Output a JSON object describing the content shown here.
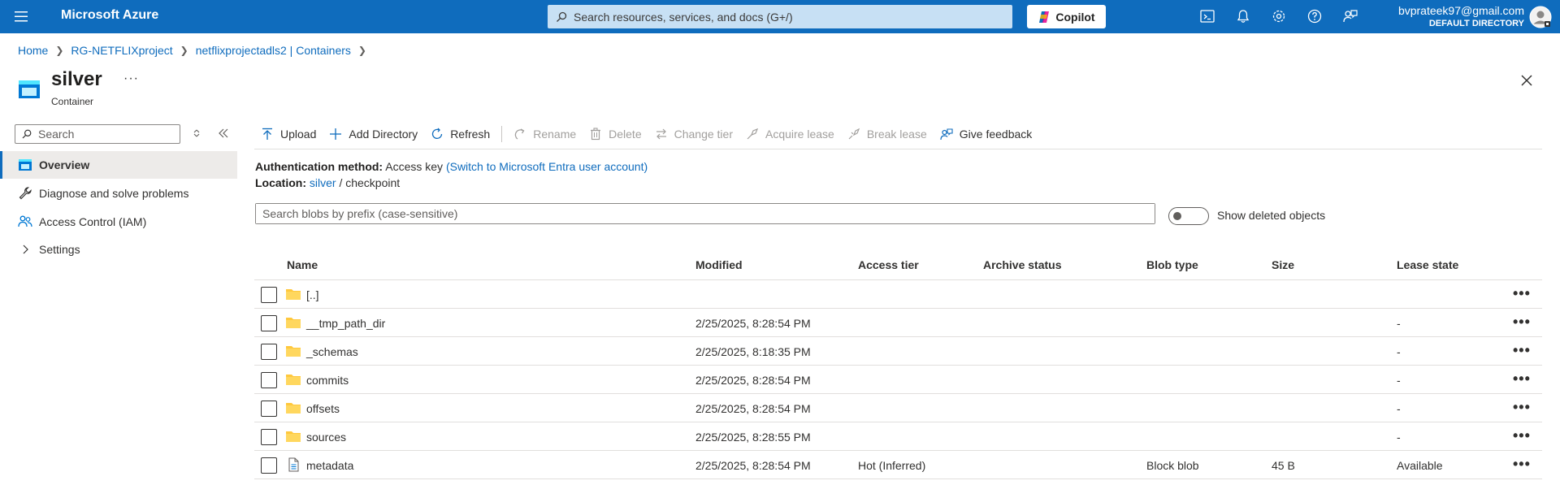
{
  "topbar": {
    "brand": "Microsoft Azure",
    "search_placeholder": "Search resources, services, and docs (G+/)",
    "copilot_label": "Copilot",
    "account_email": "bvprateek97@gmail.com",
    "account_directory": "DEFAULT DIRECTORY",
    "icons": [
      "cloud-shell-icon",
      "bell-icon",
      "gear-icon",
      "help-icon",
      "feedback-icon"
    ]
  },
  "breadcrumb": {
    "items": [
      "Home",
      "RG-NETFLIXproject",
      "netflixprojectadls2 | Containers"
    ]
  },
  "header": {
    "title": "silver",
    "subtitle": "Container",
    "more": "···"
  },
  "nav": {
    "search_placeholder": "Search",
    "items": [
      {
        "label": "Overview",
        "icon": "container-icon",
        "active": true
      },
      {
        "label": "Diagnose and solve problems",
        "icon": "wrench-icon"
      },
      {
        "label": "Access Control (IAM)",
        "icon": "people-icon"
      },
      {
        "label": "Settings",
        "icon": "chevron-right-icon"
      }
    ]
  },
  "toolbar": {
    "upload": "Upload",
    "add_directory": "Add Directory",
    "refresh": "Refresh",
    "rename": "Rename",
    "delete": "Delete",
    "change_tier": "Change tier",
    "acquire_lease": "Acquire lease",
    "break_lease": "Break lease",
    "give_feedback": "Give feedback"
  },
  "info": {
    "auth_label": "Authentication method:",
    "auth_value": "Access key",
    "auth_link": "(Switch to Microsoft Entra user account)",
    "location_label": "Location:",
    "location_link": "silver",
    "location_sep": "/",
    "location_value": "checkpoint"
  },
  "blob_search": {
    "placeholder": "Search blobs by prefix (case-sensitive)",
    "toggle_label": "Show deleted objects"
  },
  "table": {
    "columns": [
      "Name",
      "Modified",
      "Access tier",
      "Archive status",
      "Blob type",
      "Size",
      "Lease state"
    ],
    "rows": [
      {
        "icon": "folder-icon",
        "name": "[..]",
        "modified": "",
        "access_tier": "",
        "archive_status": "",
        "blob_type": "",
        "size": "",
        "lease_state": ""
      },
      {
        "icon": "folder-icon",
        "name": "__tmp_path_dir",
        "modified": "2/25/2025, 8:28:54 PM",
        "access_tier": "",
        "archive_status": "",
        "blob_type": "",
        "size": "",
        "lease_state": "-"
      },
      {
        "icon": "folder-icon",
        "name": "_schemas",
        "modified": "2/25/2025, 8:18:35 PM",
        "access_tier": "",
        "archive_status": "",
        "blob_type": "",
        "size": "",
        "lease_state": "-"
      },
      {
        "icon": "folder-icon",
        "name": "commits",
        "modified": "2/25/2025, 8:28:54 PM",
        "access_tier": "",
        "archive_status": "",
        "blob_type": "",
        "size": "",
        "lease_state": "-"
      },
      {
        "icon": "folder-icon",
        "name": "offsets",
        "modified": "2/25/2025, 8:28:54 PM",
        "access_tier": "",
        "archive_status": "",
        "blob_type": "",
        "size": "",
        "lease_state": "-"
      },
      {
        "icon": "folder-icon",
        "name": "sources",
        "modified": "2/25/2025, 8:28:55 PM",
        "access_tier": "",
        "archive_status": "",
        "blob_type": "",
        "size": "",
        "lease_state": "-"
      },
      {
        "icon": "file-icon",
        "name": "metadata",
        "modified": "2/25/2025, 8:28:54 PM",
        "access_tier": "Hot (Inferred)",
        "archive_status": "",
        "blob_type": "Block blob",
        "size": "45 B",
        "lease_state": "Available"
      }
    ],
    "row_more": "•••"
  },
  "colors": {
    "topbar": "#0f6cbd",
    "link": "#0f6cbd",
    "folder": "#ffc83d",
    "nav_active": "#edebe9"
  }
}
